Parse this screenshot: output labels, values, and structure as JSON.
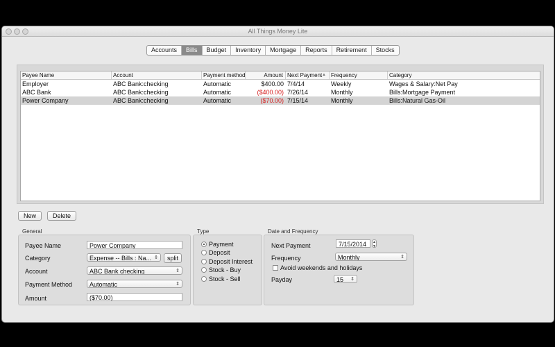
{
  "window": {
    "title": "All Things Money Lite"
  },
  "tabs": [
    {
      "label": "Accounts"
    },
    {
      "label": "Bills"
    },
    {
      "label": "Budget"
    },
    {
      "label": "Inventory"
    },
    {
      "label": "Mortgage"
    },
    {
      "label": "Reports"
    },
    {
      "label": "Retirement"
    },
    {
      "label": "Stocks"
    }
  ],
  "active_tab": "Bills",
  "table": {
    "columns": [
      "Payee Name",
      "Account",
      "Payment method",
      "Amount",
      "Next Payment",
      "Frequency",
      "Category"
    ],
    "sorted_column": "Next Payment",
    "rows": [
      {
        "payee": "Employer",
        "account": "ABC Bank:checking",
        "method": "Automatic",
        "amount": "$400.00",
        "next": "7/4/14",
        "frequency": "Weekly",
        "category": "Wages & Salary:Net Pay",
        "negative": false,
        "selected": false
      },
      {
        "payee": "ABC Bank",
        "account": "ABC Bank:checking",
        "method": "Automatic",
        "amount": "($400.00)",
        "next": "7/26/14",
        "frequency": "Monthly",
        "category": "Bills:Mortgage Payment",
        "negative": true,
        "selected": false
      },
      {
        "payee": "Power Company",
        "account": "ABC Bank:checking",
        "method": "Automatic",
        "amount": "($70.00)",
        "next": "7/15/14",
        "frequency": "Monthly",
        "category": "Bills:Natural Gas-Oil",
        "negative": true,
        "selected": true
      }
    ]
  },
  "buttons": {
    "new": "New",
    "delete": "Delete",
    "split": "split"
  },
  "general": {
    "title": "General",
    "payee_label": "Payee Name",
    "payee_value": "Power Company",
    "category_label": "Category",
    "category_value": "Expense -- Bills : Na...",
    "account_label": "Account",
    "account_value": "ABC Bank checking",
    "method_label": "Payment Method",
    "method_value": "Automatic",
    "amount_label": "Amount",
    "amount_value": "($70.00)"
  },
  "type": {
    "title": "Type",
    "options": [
      "Payment",
      "Deposit",
      "Deposit Interest",
      "Stock - Buy",
      "Stock - Sell"
    ],
    "selected": "Payment"
  },
  "date_freq": {
    "title": "Date and Frequency",
    "next_label": "Next Payment",
    "next_value": "7/15/2014",
    "freq_label": "Frequency",
    "freq_value": "Monthly",
    "avoid_label": "Avoid weekends and holidays",
    "avoid_checked": false,
    "payday_label": "Payday",
    "payday_value": "15"
  },
  "colors": {
    "negative": "#d52020",
    "active_tab": "#8a8a8a",
    "selected_row": "#d4d4d4"
  }
}
